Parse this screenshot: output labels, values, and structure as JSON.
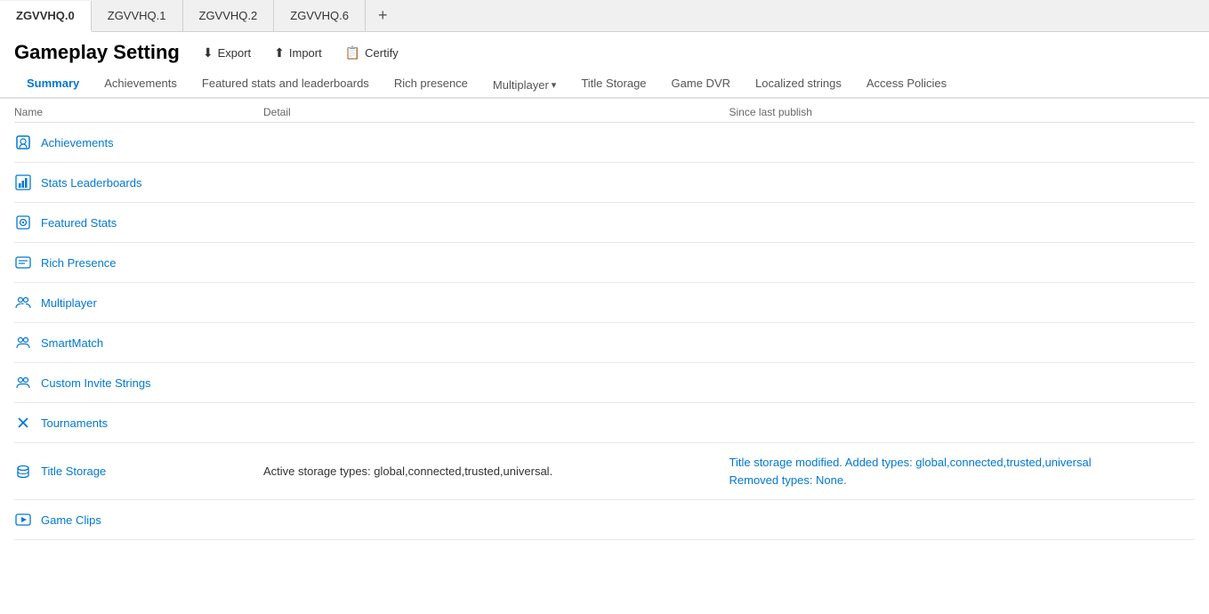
{
  "tabs": [
    {
      "id": "zgvvhq0",
      "label": "ZGVVHQ.0",
      "active": true
    },
    {
      "id": "zgvvhq1",
      "label": "ZGVVHQ.1",
      "active": false
    },
    {
      "id": "zgvvhq2",
      "label": "ZGVVHQ.2",
      "active": false
    },
    {
      "id": "zgvvhq6",
      "label": "ZGVVHQ.6",
      "active": false
    }
  ],
  "tab_add_label": "+",
  "page_title": "Gameplay Setting",
  "actions": {
    "export_label": "Export",
    "import_label": "Import",
    "certify_label": "Certify"
  },
  "nav_tabs": [
    {
      "id": "summary",
      "label": "Summary",
      "active": true
    },
    {
      "id": "achievements",
      "label": "Achievements",
      "active": false
    },
    {
      "id": "featured",
      "label": "Featured stats and leaderboards",
      "active": false
    },
    {
      "id": "rich-presence",
      "label": "Rich presence",
      "active": false
    },
    {
      "id": "multiplayer",
      "label": "Multiplayer",
      "active": false,
      "dropdown": true
    },
    {
      "id": "title-storage",
      "label": "Title Storage",
      "active": false
    },
    {
      "id": "game-dvr",
      "label": "Game DVR",
      "active": false
    },
    {
      "id": "localized-strings",
      "label": "Localized strings",
      "active": false
    },
    {
      "id": "access-policies",
      "label": "Access Policies",
      "active": false
    }
  ],
  "table": {
    "headers": {
      "name": "Name",
      "detail": "Detail",
      "since": "Since last publish"
    },
    "rows": [
      {
        "id": "achievements",
        "name": "Achievements",
        "icon": "🏆",
        "icon_type": "achievements",
        "detail": "",
        "since": ""
      },
      {
        "id": "stats-leaderboards",
        "name": "Stats Leaderboards",
        "icon": "📊",
        "icon_type": "stats-leaderboards",
        "detail": "",
        "since": ""
      },
      {
        "id": "featured-stats",
        "name": "Featured Stats",
        "icon": "⭐",
        "icon_type": "featured-stats",
        "detail": "",
        "since": ""
      },
      {
        "id": "rich-presence",
        "name": "Rich Presence",
        "icon": "💬",
        "icon_type": "rich-presence",
        "detail": "",
        "since": ""
      },
      {
        "id": "multiplayer",
        "name": "Multiplayer",
        "icon": "👥",
        "icon_type": "multiplayer",
        "detail": "",
        "since": ""
      },
      {
        "id": "smartmatch",
        "name": "SmartMatch",
        "icon": "👥",
        "icon_type": "smartmatch",
        "detail": "",
        "since": ""
      },
      {
        "id": "custom-invite-strings",
        "name": "Custom Invite Strings",
        "icon": "👥",
        "icon_type": "custom-invite-strings",
        "detail": "",
        "since": ""
      },
      {
        "id": "tournaments",
        "name": "Tournaments",
        "icon": "✖",
        "icon_type": "tournaments",
        "detail": "",
        "since": ""
      },
      {
        "id": "title-storage",
        "name": "Title Storage",
        "icon": "💾",
        "icon_type": "title-storage",
        "detail": "Active storage types: global,connected,trusted,universal.",
        "since_line1": "Title storage modified. Added types: global,connected,trusted,universal",
        "since_line2": "Removed types: None."
      },
      {
        "id": "game-clips",
        "name": "Game Clips",
        "icon": "🎬",
        "icon_type": "game-clips",
        "detail": "",
        "since": ""
      }
    ]
  },
  "colors": {
    "accent": "#0078d4",
    "border": "#e0e0e0",
    "text_muted": "#666"
  }
}
